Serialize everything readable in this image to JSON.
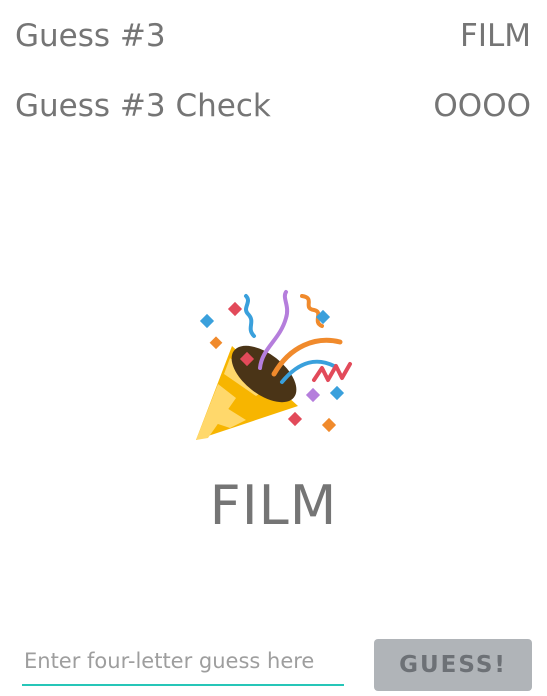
{
  "guess_row": {
    "label": "Guess #3",
    "value": "FILM"
  },
  "check_row": {
    "label": "Guess #3 Check",
    "value": "OOOO"
  },
  "celebration": {
    "icon": "party-popper-icon"
  },
  "answer": {
    "word": "FILM"
  },
  "input": {
    "placeholder": "Enter four-letter guess here",
    "value": ""
  },
  "button": {
    "label": "GUESS!"
  },
  "colors": {
    "text": "#757575",
    "input_underline": "#26c6b8",
    "button_bg": "#b0b4b8",
    "button_text": "#6d7176"
  }
}
